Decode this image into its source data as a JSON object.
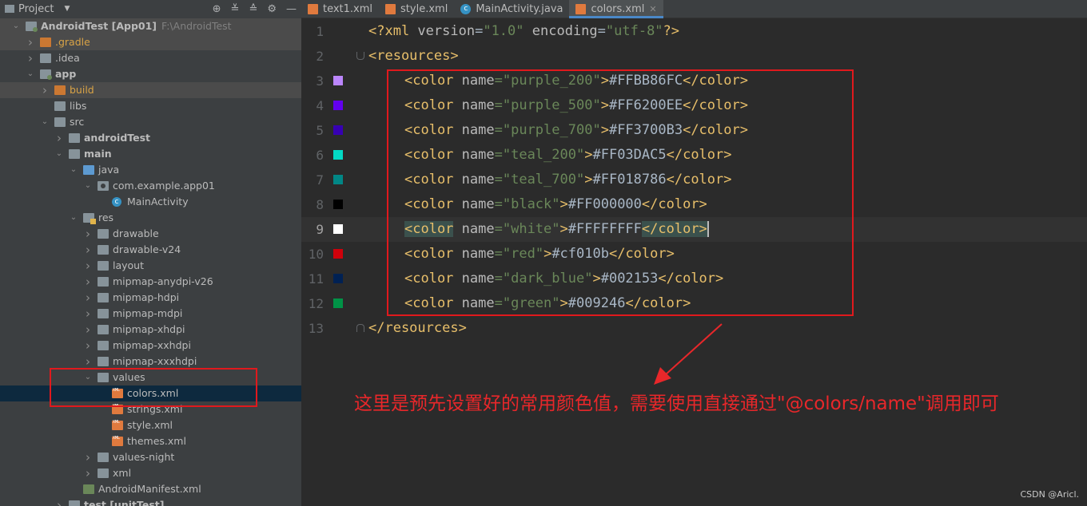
{
  "project_panel": {
    "title": "Project",
    "tree": [
      {
        "label": "AndroidTest [App01]",
        "path": "F:\\AndroidTest",
        "depth": 0,
        "arrow": "down",
        "icon": "module",
        "bold": true,
        "hl": true
      },
      {
        "label": ".gradle",
        "depth": 1,
        "arrow": "right",
        "icon": "folder-orange",
        "excluded": true,
        "hl": true
      },
      {
        "label": ".idea",
        "depth": 1,
        "arrow": "right",
        "icon": "folder"
      },
      {
        "label": "app",
        "depth": 1,
        "arrow": "down",
        "icon": "folder-module",
        "bold": true
      },
      {
        "label": "build",
        "depth": 2,
        "arrow": "right",
        "icon": "folder-orange",
        "excluded": true,
        "hl": true
      },
      {
        "label": "libs",
        "depth": 2,
        "icon": "folder"
      },
      {
        "label": "src",
        "depth": 2,
        "arrow": "down",
        "icon": "folder"
      },
      {
        "label": "androidTest",
        "depth": 3,
        "arrow": "right",
        "icon": "folder",
        "bold": true
      },
      {
        "label": "main",
        "depth": 3,
        "arrow": "down",
        "icon": "folder",
        "bold": true
      },
      {
        "label": "java",
        "depth": 4,
        "arrow": "down",
        "icon": "folder-blue"
      },
      {
        "label": "com.example.app01",
        "depth": 5,
        "arrow": "down",
        "icon": "package"
      },
      {
        "label": "MainActivity",
        "depth": 6,
        "icon": "class"
      },
      {
        "label": "res",
        "depth": 4,
        "arrow": "down",
        "icon": "folder-res"
      },
      {
        "label": "drawable",
        "depth": 5,
        "arrow": "right",
        "icon": "folder"
      },
      {
        "label": "drawable-v24",
        "depth": 5,
        "arrow": "right",
        "icon": "folder"
      },
      {
        "label": "layout",
        "depth": 5,
        "arrow": "right",
        "icon": "folder"
      },
      {
        "label": "mipmap-anydpi-v26",
        "depth": 5,
        "arrow": "right",
        "icon": "folder"
      },
      {
        "label": "mipmap-hdpi",
        "depth": 5,
        "arrow": "right",
        "icon": "folder"
      },
      {
        "label": "mipmap-mdpi",
        "depth": 5,
        "arrow": "right",
        "icon": "folder"
      },
      {
        "label": "mipmap-xhdpi",
        "depth": 5,
        "arrow": "right",
        "icon": "folder"
      },
      {
        "label": "mipmap-xxhdpi",
        "depth": 5,
        "arrow": "right",
        "icon": "folder"
      },
      {
        "label": "mipmap-xxxhdpi",
        "depth": 5,
        "arrow": "right",
        "icon": "folder"
      },
      {
        "label": "values",
        "depth": 5,
        "arrow": "down",
        "icon": "folder"
      },
      {
        "label": "colors.xml",
        "depth": 6,
        "icon": "xml",
        "selected": true
      },
      {
        "label": "strings.xml",
        "depth": 6,
        "icon": "xml"
      },
      {
        "label": "style.xml",
        "depth": 6,
        "icon": "xml"
      },
      {
        "label": "themes.xml",
        "depth": 6,
        "icon": "xml"
      },
      {
        "label": "values-night",
        "depth": 5,
        "arrow": "right",
        "icon": "folder"
      },
      {
        "label": "xml",
        "depth": 5,
        "arrow": "right",
        "icon": "folder"
      },
      {
        "label": "AndroidManifest.xml",
        "depth": 4,
        "icon": "manifest"
      },
      {
        "label": "test [unitTest]",
        "depth": 3,
        "arrow": "right",
        "icon": "folder",
        "bold": true
      }
    ]
  },
  "tabs": [
    {
      "label": "text1.xml",
      "icon": "xml"
    },
    {
      "label": "style.xml",
      "icon": "xml"
    },
    {
      "label": "MainActivity.java",
      "icon": "java"
    },
    {
      "label": "colors.xml",
      "icon": "xml",
      "active": true
    }
  ],
  "code_lines": [
    {
      "n": "1",
      "kind": "decl",
      "text": "<?xml version=\"1.0\" encoding=\"utf-8\"?>"
    },
    {
      "n": "2",
      "kind": "open",
      "text": "<resources>"
    },
    {
      "n": "3",
      "kind": "color",
      "name": "purple_200",
      "value": "#FFBB86FC",
      "swatch": "#BB86FC"
    },
    {
      "n": "4",
      "kind": "color",
      "name": "purple_500",
      "value": "#FF6200EE",
      "swatch": "#6200EE"
    },
    {
      "n": "5",
      "kind": "color",
      "name": "purple_700",
      "value": "#FF3700B3",
      "swatch": "#3700B3"
    },
    {
      "n": "6",
      "kind": "color",
      "name": "teal_200",
      "value": "#FF03DAC5",
      "swatch": "#03DAC5"
    },
    {
      "n": "7",
      "kind": "color",
      "name": "teal_700",
      "value": "#FF018786",
      "swatch": "#018786"
    },
    {
      "n": "8",
      "kind": "color",
      "name": "black",
      "value": "#FF000000",
      "swatch": "#000000"
    },
    {
      "n": "9",
      "kind": "color",
      "name": "white",
      "value": "#FFFFFFFF",
      "swatch": "#FFFFFF",
      "current": true
    },
    {
      "n": "10",
      "kind": "color",
      "name": "red",
      "value": "#cf010b",
      "swatch": "#cf010b"
    },
    {
      "n": "11",
      "kind": "color",
      "name": "dark_blue",
      "value": "#002153",
      "swatch": "#002153"
    },
    {
      "n": "12",
      "kind": "color",
      "name": "green",
      "value": "#009246",
      "swatch": "#009246"
    },
    {
      "n": "13",
      "kind": "close",
      "text": "</resources>"
    }
  ],
  "annotation": {
    "text": "这里是预先设置好的常用颜色值，需要使用直接通过\"@colors/name\"调用即可",
    "color": "#e8272a"
  },
  "watermark": "CSDN @Aricl."
}
